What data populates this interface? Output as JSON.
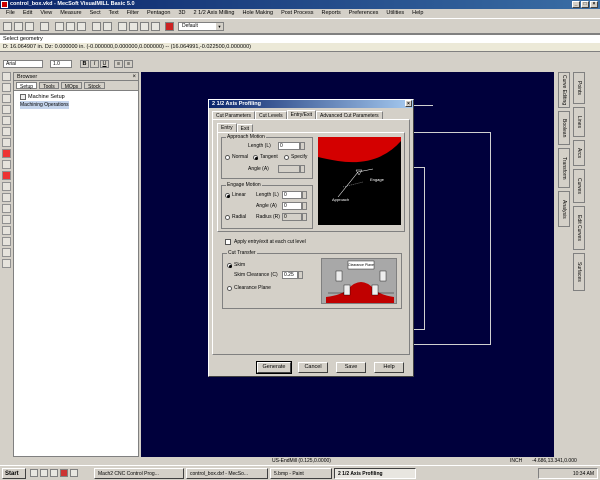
{
  "window": {
    "title": "control_box.vkd - MecSoft VisualMILL Basic 5.0"
  },
  "menu": [
    "File",
    "Edit",
    "View",
    "Measure",
    "Sect",
    "Text",
    "Filter",
    "Pentagon",
    "3D",
    "2 1/2 Axis Milling",
    "Hole Making",
    "Post Process",
    "Reports",
    "Preferences",
    "Utilities",
    "Help"
  ],
  "toolbar": {
    "layer_combo": "Default"
  },
  "geometry_bar": {
    "label": "Select geometry"
  },
  "coord_bar": {
    "text": "D: 16.064907 in. Dz: 0.000000 in. (-0.000000,0.000000,0.000000) -- (16.064991,-0.022500,0.000000)"
  },
  "format_bar": {
    "font": "Arial",
    "size": "1.0",
    "bold": "B",
    "italic": "I",
    "underline": "U"
  },
  "browser": {
    "title": "Browser",
    "tabs": [
      "Setup",
      "Tools",
      "MOps",
      "Stock"
    ],
    "tree": [
      "Machine Setup",
      "Machining Operations"
    ]
  },
  "right_tabs": [
    [
      "Points",
      "Lines",
      "Arcs",
      "Curves",
      "Edit Curves",
      "Surfaces"
    ],
    [
      "Curve Editing",
      "Boolean",
      "Transform",
      "Analysis"
    ]
  ],
  "dialog": {
    "title": "2 1/2 Axis Profiling",
    "tabs": [
      "Cut Parameters",
      "Cut Levels",
      "Entry/Exit",
      "Advanced Cut Parameters"
    ],
    "active_tab": "Entry/Exit",
    "sub_tabs": [
      "Entry",
      "Exit"
    ],
    "approach": {
      "group": "Approach Motion",
      "length_label": "Length (L)",
      "length_value": "0",
      "options": [
        "Normal",
        "Tangent",
        "Specify"
      ],
      "selected": "Tangent",
      "angle_label": "Angle (A)",
      "angle_value": ""
    },
    "engage": {
      "group": "Engage Motion",
      "options": [
        "Linear",
        "Radial"
      ],
      "selected": "Linear",
      "length_label": "Length (L)",
      "length_value": "0",
      "angle_label": "Angle (A)",
      "angle_value": "0",
      "radius_label": "Radius (R)",
      "radius_value": "0"
    },
    "preview_labels": {
      "engage": "Engage",
      "approach": "Approach"
    },
    "apply_entry_label": "Apply entry/exit at each cut level",
    "cut_transfer": {
      "group": "Cut Transfer",
      "options": [
        "Skim",
        "Clearance Plane"
      ],
      "selected": "Skim",
      "skim_label": "Skim Clearance (C)",
      "skim_value": "0.25",
      "preview_label": "Clearance\nPlane"
    },
    "buttons": [
      "Generate",
      "Cancel",
      "Save",
      "Help"
    ]
  },
  "status": {
    "center": "US-EndMill (0.125,0.0000)",
    "units": "INCH",
    "coords": "-4.686,13.341,0.000"
  },
  "taskbar": {
    "start": "Start",
    "tasks": [
      "Mach2 CNC Control Prog...",
      "control_box.dxf - MecSo...",
      "5.bmp - Paint",
      "2 1/2 Axis Profiling"
    ],
    "active": "2 1/2 Axis Profiling",
    "clock": "10:34 AM"
  },
  "colors": {
    "canvas": "#00003c",
    "titlebar": "#0a246a",
    "preview_red": "#d40000"
  }
}
